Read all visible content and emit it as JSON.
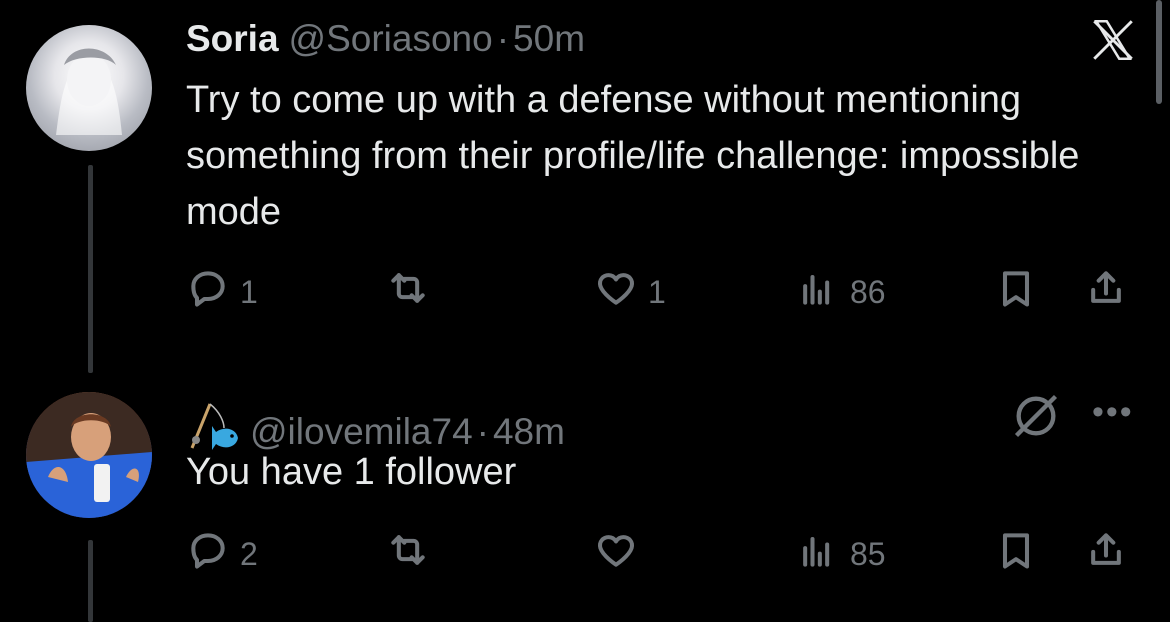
{
  "tweets": [
    {
      "name": "Soria",
      "handle": "@Soriasono",
      "separator": "·",
      "time": "50m",
      "text": "Try to come up with a defense without mentioning something from their profile/life challenge: impossible mode",
      "replies": "1",
      "reposts": "",
      "likes": "1",
      "views": "86"
    },
    {
      "handle": "@ilovemila74",
      "separator": "·",
      "time": "48m",
      "text": "You have 1 follower",
      "replies": "2",
      "reposts": "",
      "likes": "",
      "views": "85"
    }
  ],
  "icons": {
    "close": "x-logo-icon",
    "reply": "reply-icon",
    "repost": "repost-icon",
    "like": "heart-icon",
    "views": "views-icon",
    "bookmark": "bookmark-icon",
    "share": "share-icon",
    "mute": "mute-icon",
    "more": "more-icon",
    "badge": "fishing-icon"
  },
  "more_label": "•••",
  "colors": {
    "background": "#000000",
    "text": "#e7e9ea",
    "secondary": "#71767b",
    "thread_line": "#333639"
  }
}
